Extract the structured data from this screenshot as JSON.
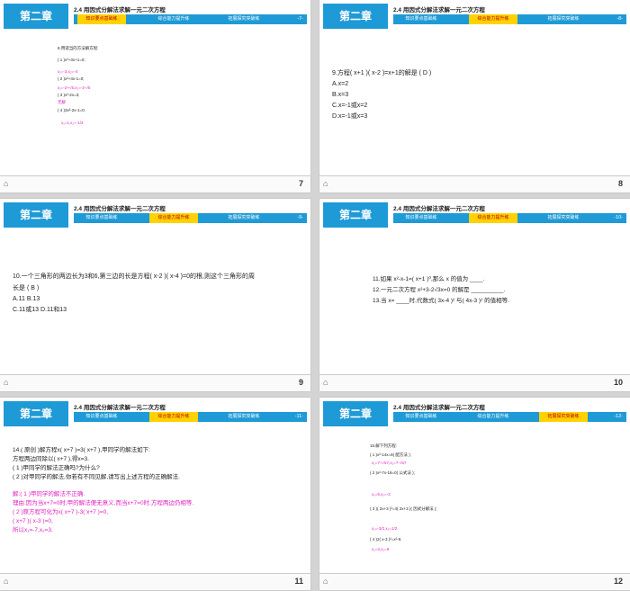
{
  "header": {
    "chapter": "第二章",
    "title": "2.4  用因式分解法求解一元二次方程",
    "tabs": [
      "知识要点基础练",
      "综合能力提升练",
      "拓展探究突破练"
    ]
  },
  "slides": [
    {
      "page": "-7-",
      "number": "7",
      "active_tab": 0,
      "lines": [
        {
          "text": "8.用适当的方法解方程:",
          "pink": false
        },
        {
          "text": "( 1 )x²+3x+1=0;",
          "pink": false
        },
        {
          "text": "x₁=-3,x₂=-4",
          "pink": true
        },
        {
          "text": "( 2 )x²+4x-1=0;",
          "pink": false
        },
        {
          "text": "x₁=-2+√5,x₂=-2-√5",
          "pink": true
        },
        {
          "text": "( 3 )x²-2x=3;",
          "pink": false
        },
        {
          "text": "无解",
          "pink": true
        },
        {
          "text": "( 4 )3x²-2x-1=0.",
          "pink": false
        },
        {
          "text": "x₁=1,x₂=-1/3",
          "pink": true
        }
      ]
    },
    {
      "page": "-8-",
      "number": "8",
      "active_tab": 1,
      "lines": [
        {
          "text": "9.方程( x+1 )( x-2 )=x+1的解是 ( D )",
          "pink": false
        },
        {
          "text": "A.x=2",
          "pink": false
        },
        {
          "text": "B.x=3",
          "pink": false
        },
        {
          "text": "C.x=-1或x=2",
          "pink": false
        },
        {
          "text": "D.x=-1或x=3",
          "pink": false
        }
      ]
    },
    {
      "page": "-9-",
      "number": "9",
      "active_tab": 1,
      "lines": [
        {
          "text": "10.一个三角形的两边长为3和6,第三边的长是方程( x-2 )( x-4 )=0的根,则这个三角形的周",
          "pink": false
        },
        {
          "text": "长是 ( B )",
          "pink": false
        },
        {
          "text": "A.11      B.13",
          "pink": false
        },
        {
          "text": "C.11或13      D.11和13",
          "pink": false
        }
      ]
    },
    {
      "page": "-10-",
      "number": "10",
      "active_tab": 1,
      "lines": [
        {
          "text": "11.如果 x²-x-1=( x+1 )⁰,那么 x 的值为 ____.",
          "pink": false
        },
        {
          "text": "12.一元二次方程 x²+3-2√3x=0 的解是 __________.",
          "pink": false
        },
        {
          "text": "13.当 x= ____时,代数式( 3x-4 )² 与( 4x-3 )² 的值相等.",
          "pink": false
        }
      ]
    },
    {
      "page": "-11-",
      "number": "11",
      "active_tab": 1,
      "lines": [
        {
          "text": "14.( 原创 )解方程x( x+7 )=3( x+7 ),甲同学的解法如下:",
          "pink": false
        },
        {
          "text": "方程两边同除以( x+7 ),得x=3.",
          "pink": false
        },
        {
          "text": "( 1 )甲同学的解法正确吗?为什么?",
          "pink": false
        },
        {
          "text": "( 2 )对甲同学的解法,你若有不同见解,请写出上述方程的正确解法.",
          "pink": false
        },
        {
          "text": "",
          "pink": false
        },
        {
          "text": "解:( 1 )甲同学的解法不正确.",
          "pink": true
        },
        {
          "text": "理由:因为当x+7=0时,甲的解法便无意义,而当x+7=0时,方程两边仍相等.",
          "pink": true
        },
        {
          "text": "( 2 )原方程可化为x( x+7 )-3( x+7 )=0,",
          "pink": true
        },
        {
          "text": "( x+7 )( x-3 )=0,",
          "pink": true
        },
        {
          "text": "所以x₁=-7,x₂=3.",
          "pink": true
        }
      ]
    },
    {
      "page": "-12-",
      "number": "12",
      "active_tab": 2,
      "lines": [
        {
          "text": "15.解下列方程:",
          "pink": false
        },
        {
          "text": "( 1 )x²-14x=8( 配方法 );",
          "pink": false
        },
        {
          "text": "x₁=7+√57,x₂=7-√57",
          "pink": true
        },
        {
          "text": "( 2 )x²-7x-18=0( 公式法 );",
          "pink": false
        },
        {
          "text": "",
          "pink": false
        },
        {
          "text": "x₁=9,x₂=-2",
          "pink": true
        },
        {
          "text": "( 3 )( 2x+3 )²=4( 2x+3 )( 因式分解法 );",
          "pink": false
        },
        {
          "text": "",
          "pink": false
        },
        {
          "text": "x₁=-3/2,x₂=1/2",
          "pink": true
        },
        {
          "text": "( 4 )2( x-3 )²=x²-9.",
          "pink": false
        },
        {
          "text": "x₁=3,x₂=9",
          "pink": true
        }
      ]
    }
  ]
}
